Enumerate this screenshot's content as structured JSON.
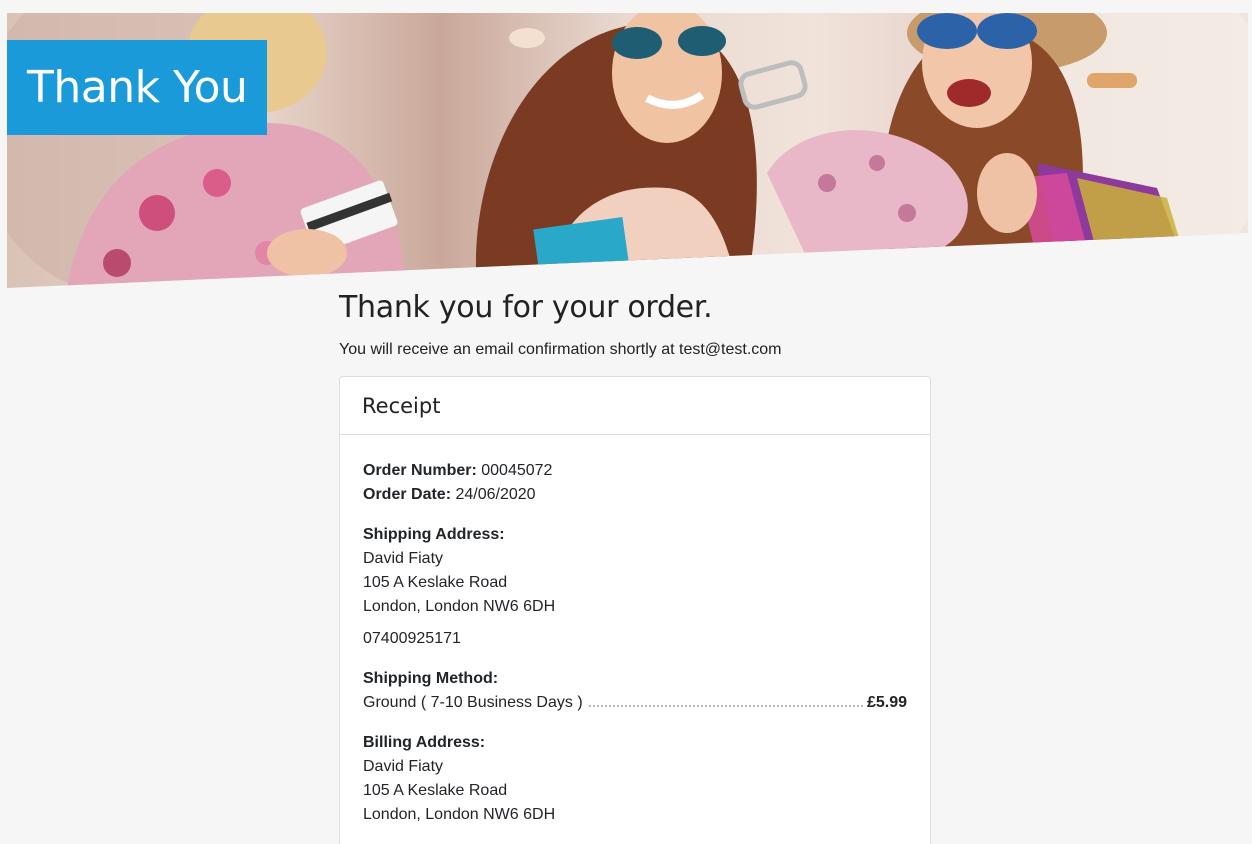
{
  "hero": {
    "title": "Thank You"
  },
  "main": {
    "heading": "Thank you for your order.",
    "confirmation_text": "You will receive an email confirmation shortly at test@test.com"
  },
  "receipt": {
    "title": "Receipt",
    "order_number_label": "Order Number:",
    "order_number": "00045072",
    "order_date_label": "Order Date:",
    "order_date": "24/06/2020",
    "shipping_address_label": "Shipping Address:",
    "shipping_name": "David Fiaty",
    "shipping_street": "105 A Keslake Road",
    "shipping_city": "London, London NW6 6DH",
    "shipping_phone": "07400925171",
    "shipping_method_label": "Shipping Method:",
    "shipping_method": "Ground ( 7-10 Business Days )",
    "shipping_price": "£5.99",
    "billing_address_label": "Billing Address:",
    "billing_name": "David Fiaty",
    "billing_street": "105 A Keslake Road",
    "billing_city": "London, London NW6 6DH"
  },
  "colors": {
    "accent": "#1a9ad9",
    "background": "#f6f6f6",
    "card_border": "#dedede"
  }
}
